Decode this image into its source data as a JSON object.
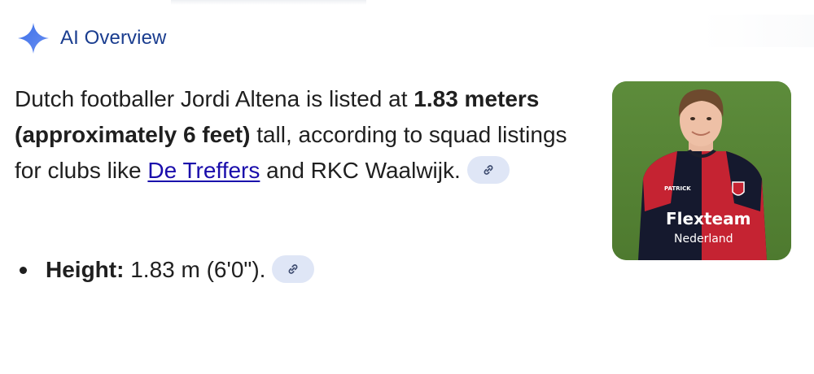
{
  "header": {
    "title": "AI Overview",
    "icon": "sparkle-icon",
    "icon_color": "#4f7cf0"
  },
  "answer": {
    "segments": {
      "intro": "Dutch footballer Jordi Altena is listed at ",
      "height_bold": "1.83 meters (approximately 6 feet)",
      "mid": " tall, according to squad listings for clubs like ",
      "link_text": "De Treffers",
      "end": " and RKC Waalwijk."
    },
    "link_icon": "link-icon",
    "link_color": "#1a0dab"
  },
  "bullets": [
    {
      "label": "Height:",
      "value": " 1.83 m (6'0\").",
      "link_icon": "link-icon"
    }
  ],
  "image": {
    "description_icon": "player-photo",
    "shirt_sponsor_line1": "Flexteam",
    "shirt_sponsor_line2": "Nederland",
    "shirt_brand": "PATRICK"
  },
  "colors": {
    "chip_bg": "#dfe6f6",
    "header_text": "#1a3d8f",
    "body_text": "#1f1f1f"
  }
}
